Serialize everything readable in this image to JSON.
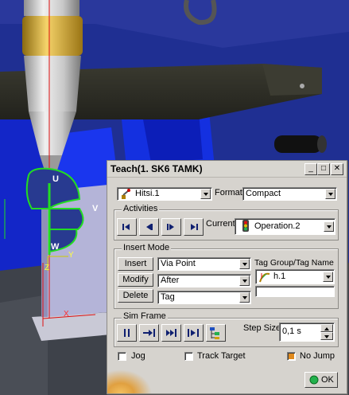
{
  "viewport": {
    "labels": {
      "u": "U",
      "v": "V",
      "w": "W",
      "y": "Y",
      "z": "Z",
      "x": "X"
    }
  },
  "dialog": {
    "title": "Teach(1. SK6 TAMK)",
    "controls": {
      "minimize": "_",
      "maximize": "□",
      "close": "✕"
    },
    "device_select": "Hitsi.1",
    "format_label": "Format",
    "format_value": "Compact",
    "activities": {
      "group_label": "Activities",
      "current_label": "Current",
      "current_value": "Operation.2",
      "buttons": [
        "go-first-icon",
        "step-back-icon",
        "step-forward-icon",
        "go-last-icon"
      ]
    },
    "insert_mode": {
      "group_label": "Insert Mode",
      "insert_label": "Insert",
      "insert_value": "Via Point",
      "modify_label": "Modify",
      "modify_value": "After",
      "delete_label": "Delete",
      "delete_value": "Tag",
      "tag_group_label": "Tag Group/Tag Name",
      "tag_value": "h.1",
      "tag_name_value": ""
    },
    "sim_frame": {
      "group_label": "Sim Frame",
      "step_size_label": "Step Size",
      "step_size_value": "0,1 s",
      "buttons": [
        "pause-icon",
        "step-to-next-icon",
        "skip-forward-icon",
        "play-to-end-icon",
        "tree-settings-icon"
      ]
    },
    "options": {
      "jog_label": "Jog",
      "jog_checked": false,
      "track_target_label": "Track Target",
      "track_target_checked": false,
      "no_jump_label": "No Jump",
      "no_jump_checked": true
    },
    "ok_label": "OK"
  },
  "colors": {
    "accent_green": "#22b14c",
    "scene_blue": "#1428d8",
    "axis_red": "#e01010"
  }
}
